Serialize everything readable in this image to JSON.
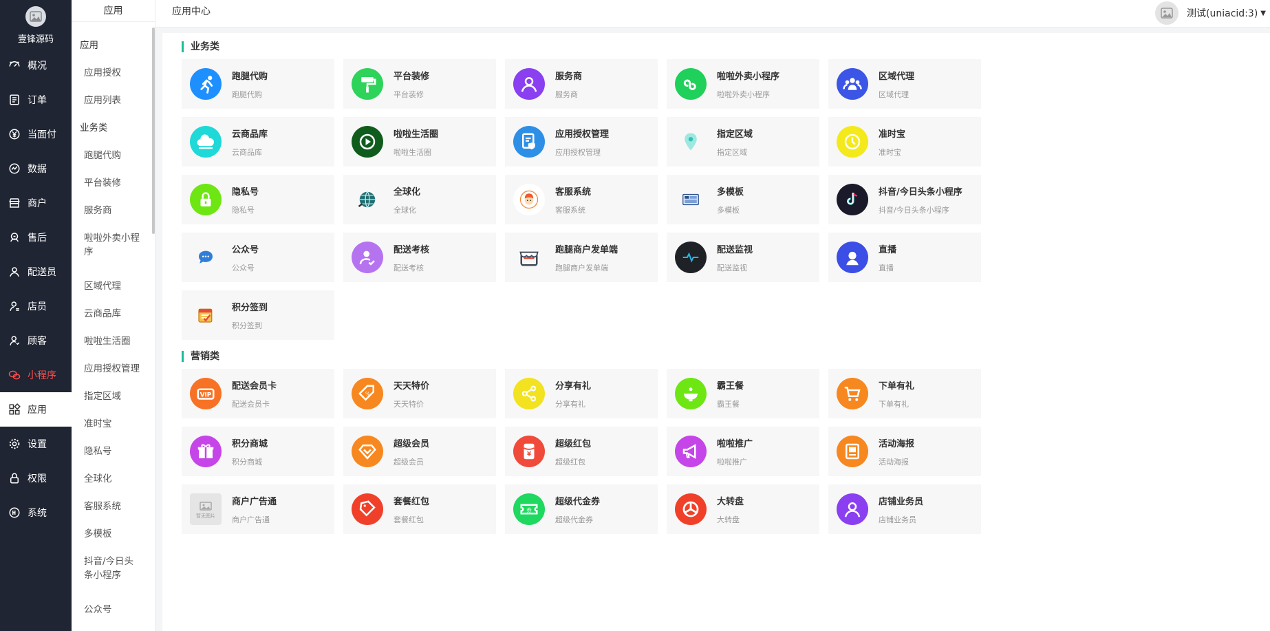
{
  "nav": {
    "brand": "壹锋源码",
    "items": [
      {
        "label": "概况",
        "icon": "dashboard-icon"
      },
      {
        "label": "订单",
        "icon": "order-icon"
      },
      {
        "label": "当面付",
        "icon": "yen-icon"
      },
      {
        "label": "数据",
        "icon": "chart-icon"
      },
      {
        "label": "商户",
        "icon": "shop-icon"
      },
      {
        "label": "售后",
        "icon": "aftersale-icon"
      },
      {
        "label": "配送员",
        "icon": "rider-icon"
      },
      {
        "label": "店员",
        "icon": "clerk-icon"
      },
      {
        "label": "顾客",
        "icon": "customer-icon"
      },
      {
        "label": "小程序",
        "icon": "wechat-icon",
        "red": true
      },
      {
        "label": "应用",
        "icon": "apps-icon",
        "active": true
      },
      {
        "label": "设置",
        "icon": "gear-icon"
      },
      {
        "label": "权限",
        "icon": "lock-icon"
      },
      {
        "label": "系统",
        "icon": "system-icon"
      }
    ]
  },
  "sub": {
    "title": "应用",
    "items": [
      {
        "label": "应用",
        "group": true
      },
      {
        "label": "应用授权"
      },
      {
        "label": "应用列表"
      },
      {
        "label": "业务类",
        "group": true
      },
      {
        "label": "跑腿代购"
      },
      {
        "label": "平台装修"
      },
      {
        "label": "服务商"
      },
      {
        "label": "啦啦外卖小程",
        "wrap": 1
      },
      {
        "label": "序",
        "wrap": 2
      },
      {
        "label": "区域代理"
      },
      {
        "label": "云商品库"
      },
      {
        "label": "啦啦生活圈"
      },
      {
        "label": "应用授权管理"
      },
      {
        "label": "指定区域"
      },
      {
        "label": "准时宝"
      },
      {
        "label": "隐私号"
      },
      {
        "label": "全球化"
      },
      {
        "label": "客服系统"
      },
      {
        "label": "多模板"
      },
      {
        "label": "抖音/今日头",
        "wrap": 1
      },
      {
        "label": "条小程序",
        "wrap": 2
      },
      {
        "label": "公众号"
      }
    ]
  },
  "header": {
    "breadcrumb": "应用中心",
    "user": "测试(uniacid:3)"
  },
  "sections": [
    {
      "title": "业务类",
      "apps": [
        {
          "name": "跑腿代购",
          "desc": "跑腿代购",
          "color": "#1e8fff",
          "icon": "running-icon"
        },
        {
          "name": "平台装修",
          "desc": "平台装修",
          "color": "#2ed35a",
          "icon": "paint-roller-icon"
        },
        {
          "name": "服务商",
          "desc": "服务商",
          "color": "#8a3ff0",
          "icon": "user-icon"
        },
        {
          "name": "啦啦外卖小程序",
          "desc": "啦啦外卖小程序",
          "color": "#1fd05a",
          "icon": "mini-program-icon"
        },
        {
          "name": "区域代理",
          "desc": "区域代理",
          "color": "#3b55e6",
          "icon": "group-icon"
        },
        {
          "name": "云商品库",
          "desc": "云商品库",
          "color": "#1fd8d8",
          "icon": "cloud-icon"
        },
        {
          "name": "啦啦生活圈",
          "desc": "啦啦生活圈",
          "color": "#0f5c1d",
          "icon": "play-circle-icon"
        },
        {
          "name": "应用授权管理",
          "desc": "应用授权管理",
          "color": "#2e8fe6",
          "icon": "document-shield-icon"
        },
        {
          "name": "指定区域",
          "desc": "指定区域",
          "color": "#f7f7f7",
          "icon": "map-pin-icon"
        },
        {
          "name": "准时宝",
          "desc": "准时宝",
          "color": "#f4e91b",
          "icon": "clock-icon"
        },
        {
          "name": "隐私号",
          "desc": "隐私号",
          "color": "#6ee613",
          "icon": "lock-icon"
        },
        {
          "name": "全球化",
          "desc": "全球化",
          "color": "#f7f7f7",
          "icon": "globe-icon"
        },
        {
          "name": "客服系统",
          "desc": "客服系统",
          "color": "#ffffff",
          "icon": "customer-service-icon"
        },
        {
          "name": "多模板",
          "desc": "多模板",
          "color": "#f7f7f7",
          "icon": "template-icon"
        },
        {
          "name": "抖音/今日头条小程序",
          "desc": "抖音/今日头条小程序",
          "color": "#1a1a2a",
          "icon": "tiktok-icon"
        },
        {
          "name": "公众号",
          "desc": "公众号",
          "color": "#f7f7f7",
          "icon": "chat-bubble-icon"
        },
        {
          "name": "配送考核",
          "desc": "配送考核",
          "color": "#b673f0",
          "icon": "user-check-icon"
        },
        {
          "name": "跑腿商户发单端",
          "desc": "跑腿商户发单端",
          "color": "#f7f7f7",
          "icon": "storefront-icon"
        },
        {
          "name": "配送监视",
          "desc": "配送监视",
          "color": "#1e2126",
          "icon": "pulse-icon"
        },
        {
          "name": "直播",
          "desc": "直播",
          "color": "#3b4ee6",
          "icon": "streamer-icon"
        },
        {
          "name": "积分签到",
          "desc": "积分签到",
          "color": "#f7f7f7",
          "icon": "calendar-check-icon"
        }
      ]
    },
    {
      "title": "营销类",
      "apps": [
        {
          "name": "配送会员卡",
          "desc": "配送会员卡",
          "color": "#f87225",
          "icon": "vip-card-icon"
        },
        {
          "name": "天天特价",
          "desc": "天天特价",
          "color": "#f7871f",
          "icon": "price-tag-icon"
        },
        {
          "name": "分享有礼",
          "desc": "分享有礼",
          "color": "#f2e21f",
          "icon": "share-icon"
        },
        {
          "name": "霸王餐",
          "desc": "霸王餐",
          "color": "#6ee613",
          "icon": "meal-icon"
        },
        {
          "name": "下单有礼",
          "desc": "下单有礼",
          "color": "#f7871f",
          "icon": "cart-icon"
        },
        {
          "name": "积分商城",
          "desc": "积分商城",
          "color": "#c545e8",
          "icon": "gift-icon"
        },
        {
          "name": "超级会员",
          "desc": "超级会员",
          "color": "#f7871f",
          "icon": "diamond-icon"
        },
        {
          "name": "超级红包",
          "desc": "超级红包",
          "color": "#f04a3a",
          "icon": "red-packet-icon"
        },
        {
          "name": "啦啦推广",
          "desc": "啦啦推广",
          "color": "#c545e8",
          "icon": "megaphone-icon"
        },
        {
          "name": "活动海报",
          "desc": "活动海报",
          "color": "#f7871f",
          "icon": "poster-icon"
        },
        {
          "name": "商户广告通",
          "desc": "商户广告通",
          "color": "#e5e5e5",
          "icon": "image-placeholder-icon",
          "square": true,
          "badge": "暂无图片"
        },
        {
          "name": "套餐红包",
          "desc": "套餐红包",
          "color": "#f0402a",
          "icon": "coupon-tag-icon"
        },
        {
          "name": "超级代金券",
          "desc": "超级代金券",
          "color": "#1fd860",
          "icon": "voucher-icon"
        },
        {
          "name": "大转盘",
          "desc": "大转盘",
          "color": "#f0402a",
          "icon": "wheel-icon"
        },
        {
          "name": "店铺业务员",
          "desc": "店铺业务员",
          "color": "#8a3ff0",
          "icon": "salesman-icon"
        }
      ]
    }
  ]
}
